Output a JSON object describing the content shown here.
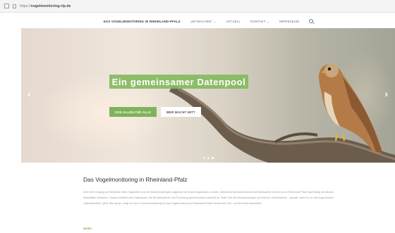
{
  "browser": {
    "url_prefix": "https://",
    "url_domain": "vogelmonitoring-rlp.de"
  },
  "nav": {
    "items": [
      {
        "label": "DAS VOGELMONITORING IN RHEINLAND-PFALZ",
        "active": true
      },
      {
        "label": "„MITMACHEN“ ⌄",
        "active": false
      },
      {
        "label": "AKTUELL",
        "active": false
      },
      {
        "label": "KONTAKT ⌄",
        "active": false
      },
      {
        "label": "IMPRESSUM",
        "active": false
      }
    ]
  },
  "hero": {
    "title": "Ein gemeinsamer Datenpool",
    "primary_button": "VON ALLEN FÜR ALLE",
    "secondary_button": "WER MACHT MIT?",
    "arrow_left": "‹",
    "arrow_right": "›",
    "slide_count": 3,
    "active_slide": 3
  },
  "section": {
    "title": "Das Vogelmonitoring in Rheinland-Pfalz",
    "paragraph": "Über den Vorgang der Bestände vieler Vogelarten und der Biodiversität ganz allgemein ist derzeit sogenannt zu lesen. Zahlreiche Beobachterinnen und Beobachter sind zu ein in Rheinland-Pfalz regelmäßig mit diesem Modalitäten befassen. Daraus entsteht eine Datenbasis, die für Naturschutz und Forschung gleichermaßen wertvoll ist. Teilen Sie Ihre Beobachtungen mit anderen Interessierten – gerade, wenn es um die sogenannten „Allerweltsarten“ geht. Wie genau, zeigt uns eine Zusammenfassung für das Vogelmonitoring in Rheinland-Pfalz! Werde jetzt Teil – es lohnt sich besonders!",
    "read_more": "weiter"
  },
  "colors": {
    "accent_green": "#7fb35a",
    "hero_title_bg": "#85ba5f"
  }
}
